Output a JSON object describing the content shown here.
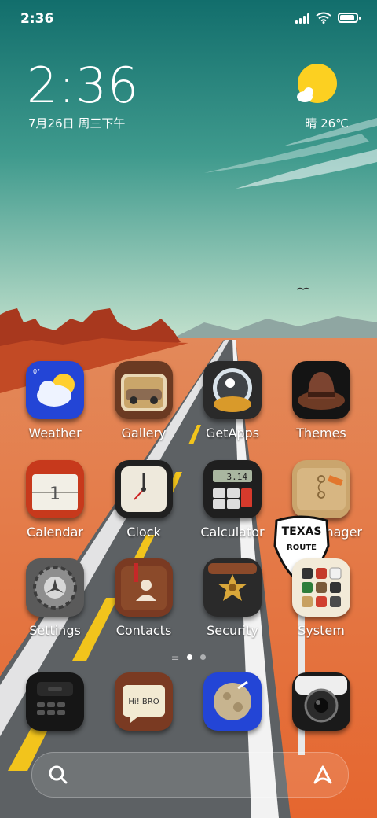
{
  "status_bar": {
    "time": "2:36",
    "battery_level": 0.9
  },
  "widget": {
    "time": "2:36",
    "date": "7月26日 周三下午",
    "weather": "晴 26℃"
  },
  "apps": [
    {
      "name": "Weather",
      "icon": "weather-icon"
    },
    {
      "name": "Gallery",
      "icon": "gallery-icon"
    },
    {
      "name": "GetApps",
      "icon": "getapps-icon"
    },
    {
      "name": "Themes",
      "icon": "themes-icon"
    },
    {
      "name": "Calendar",
      "icon": "calendar-icon",
      "icon_text": "1"
    },
    {
      "name": "Clock",
      "icon": "clock-icon"
    },
    {
      "name": "Calculator",
      "icon": "calculator-icon",
      "icon_text": "3.14"
    },
    {
      "name": "File Manager",
      "icon": "file-manager-icon"
    },
    {
      "name": "Settings",
      "icon": "settings-icon"
    },
    {
      "name": "Contacts",
      "icon": "contacts-icon"
    },
    {
      "name": "Security",
      "icon": "security-icon"
    },
    {
      "name": "System",
      "icon": "system-folder-icon"
    }
  ],
  "dock": [
    {
      "icon": "phone-icon"
    },
    {
      "icon": "messages-icon",
      "icon_text": "Hi! BRO"
    },
    {
      "icon": "browser-icon"
    },
    {
      "icon": "camera-icon"
    }
  ],
  "sign": {
    "line1": "TEXAS",
    "line2": "ROUTE"
  },
  "page_indicator": {
    "pages": 2,
    "current": 1
  }
}
